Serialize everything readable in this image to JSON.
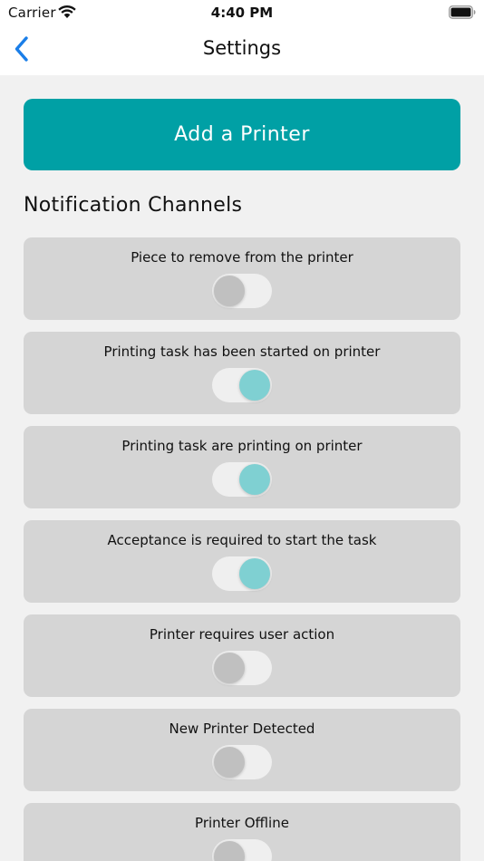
{
  "status_bar": {
    "carrier": "Carrier",
    "time": "4:40 PM",
    "icons": [
      "wifi-icon",
      "battery-icon"
    ]
  },
  "nav": {
    "title": "Settings",
    "back_icon": "chevron-left-icon",
    "accent_color": "#1a7ee8"
  },
  "main": {
    "add_printer_label": "Add a Printer",
    "add_printer_color": "#00a0a5",
    "section_title": "Notification Channels",
    "channels": [
      {
        "label": "Piece to remove from the printer",
        "enabled": false
      },
      {
        "label": "Printing task has been started on printer",
        "enabled": true
      },
      {
        "label": "Printing task are printing on printer",
        "enabled": true
      },
      {
        "label": "Acceptance is required to start the task",
        "enabled": true
      },
      {
        "label": "Printer requires user action",
        "enabled": false
      },
      {
        "label": "New Printer Detected",
        "enabled": false
      },
      {
        "label": "Printer Offline",
        "enabled": false
      }
    ],
    "toggle_on_color": "#7fd0d2",
    "toggle_off_color": "#c0c0c0"
  }
}
